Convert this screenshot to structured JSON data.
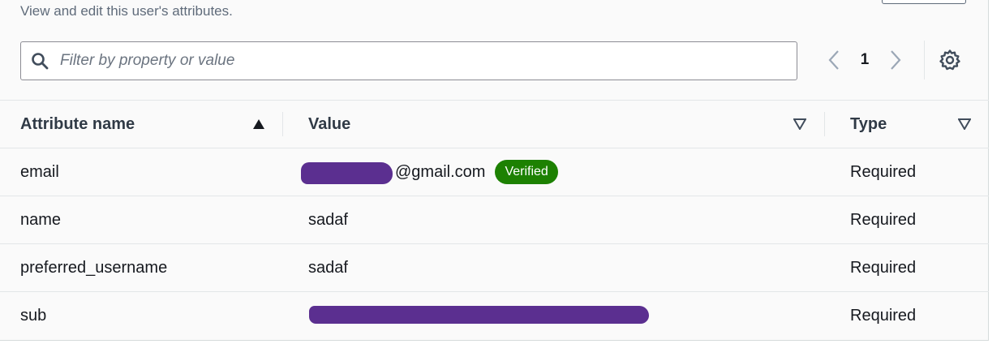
{
  "header": {
    "description": "View and edit this user's attributes."
  },
  "filter": {
    "placeholder": "Filter by property or value",
    "value": ""
  },
  "pagination": {
    "current_page": "1"
  },
  "table": {
    "columns": [
      {
        "label": "Attribute name",
        "sort": "ascending"
      },
      {
        "label": "Value",
        "sort": "none"
      },
      {
        "label": "Type",
        "sort": "none"
      }
    ],
    "rows": [
      {
        "name": "email",
        "value": "@gmail.com",
        "badge": "Verified",
        "type": "Required"
      },
      {
        "name": "name",
        "value": "sadaf",
        "type": "Required"
      },
      {
        "name": "preferred_username",
        "value": "sadaf",
        "type": "Required"
      },
      {
        "name": "sub",
        "value": "",
        "type": "Required"
      }
    ]
  },
  "colors": {
    "badge_verified": "#1d8102",
    "redaction": "#5b2f90",
    "text_primary": "#16191f",
    "text_secondary": "#5f6b7a"
  },
  "icons": [
    "search-icon",
    "chevron-left-icon",
    "chevron-right-icon",
    "gear-icon",
    "sort-ascending-icon",
    "sort-icon"
  ]
}
